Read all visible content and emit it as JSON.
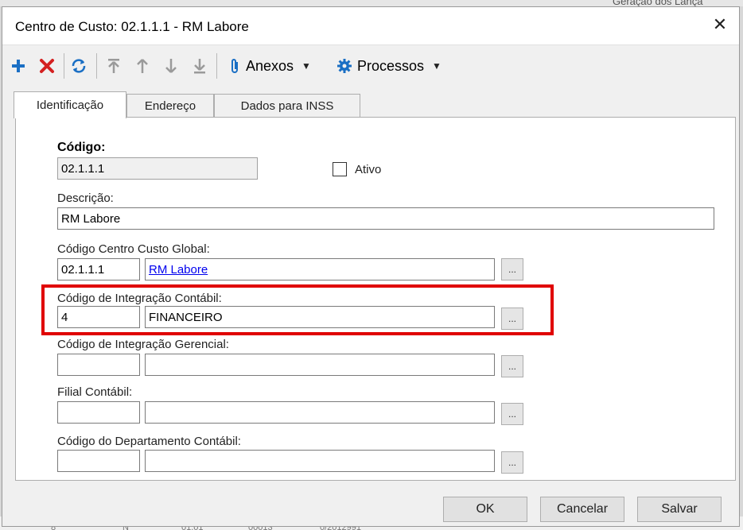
{
  "background": {
    "top_right_text": "Geração dos Lança",
    "bottom_cells": [
      "8",
      "N",
      "01.01",
      "00013",
      "0/2012991"
    ]
  },
  "window": {
    "title": "Centro de Custo: 02.1.1.1 - RM Labore",
    "close_glyph": "✕"
  },
  "toolbar": {
    "anexos_label": "Anexos",
    "processos_label": "Processos"
  },
  "tabs": [
    {
      "label": "Identificação",
      "active": true
    },
    {
      "label": "Endereço",
      "active": false
    },
    {
      "label": "Dados para INSS",
      "active": false
    }
  ],
  "form": {
    "codigo": {
      "label": "Código:",
      "value": "02.1.1.1"
    },
    "ativo": {
      "label": "Ativo",
      "checked": false
    },
    "descricao": {
      "label": "Descrição:",
      "value": "RM Labore"
    },
    "centro_custo_global": {
      "label": "Código Centro Custo Global:",
      "code": "02.1.1.1",
      "name": "RM Labore"
    },
    "integracao_contabil": {
      "label": "Código de Integração Contábil:",
      "code": "4",
      "name": "FINANCEIRO"
    },
    "integracao_gerencial": {
      "label": "Código de Integração Gerencial:",
      "code": "",
      "name": ""
    },
    "filial_contabil": {
      "label": "Filial Contábil:",
      "code": "",
      "name": ""
    },
    "departamento_contabil": {
      "label": "Código do Departamento Contábil:",
      "code": "",
      "name": ""
    },
    "lookup_glyph": "..."
  },
  "buttons": {
    "ok": "OK",
    "cancel": "Cancelar",
    "save": "Salvar"
  },
  "colors": {
    "accent_blue": "#1a6fc4",
    "delete_red": "#d42020",
    "highlight_red": "#e00000"
  }
}
